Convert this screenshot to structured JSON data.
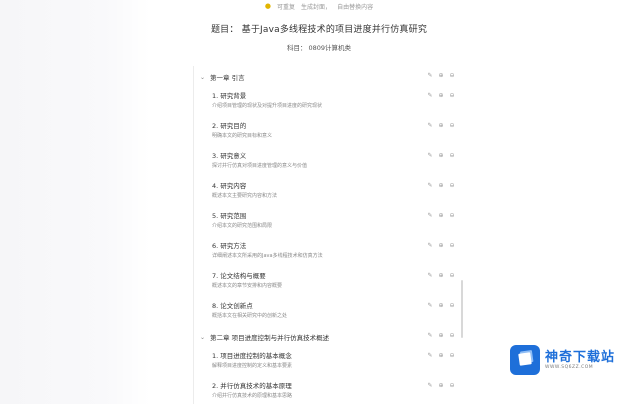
{
  "top_hint": {
    "icon": "lightbulb-icon",
    "left": "可重复",
    "mid": "生成封面，",
    "right": "自由替换内容"
  },
  "document": {
    "title": "题目：  基于Java多线程技术的项目进度并行仿真研究",
    "subject": "科目：  0809计算机类"
  },
  "outline": {
    "chapters": [
      {
        "label": "第一章 引言",
        "sections": [
          {
            "title": "1. 研究背景",
            "desc": "介绍项目管理的现状及对提升项目进度的研究现状"
          },
          {
            "title": "2. 研究目的",
            "desc": "明确本文的研究目标和意义"
          },
          {
            "title": "3. 研究意义",
            "desc": "探讨并行仿真对项目进度管理的意义与价值"
          },
          {
            "title": "4. 研究内容",
            "desc": "概述本文主要研究内容和方法"
          },
          {
            "title": "5. 研究范围",
            "desc": "介绍本文的研究范围和局限"
          },
          {
            "title": "6. 研究方法",
            "desc": "详细阐述本文所采用的Java多线程技术和仿真方法"
          },
          {
            "title": "7. 论文结构与概要",
            "desc": "概述本文的章节安排和内容概要"
          },
          {
            "title": "8. 论文创新点",
            "desc": "概括本文在相关研究中的创新之处"
          }
        ]
      },
      {
        "label": "第二章 项目进度控制与并行仿真技术概述",
        "sections": [
          {
            "title": "1. 项目进度控制的基本概念",
            "desc": "解释项目进度控制的定义和基本要素"
          },
          {
            "title": "2. 并行仿真技术的基本原理",
            "desc": "介绍并行仿真技术的原理和基本思路"
          }
        ]
      }
    ]
  },
  "watermark": {
    "name": "神奇下载站",
    "url": "WWW.SQ6ZZ.COM",
    "brand_color": "#1e6fd9"
  }
}
